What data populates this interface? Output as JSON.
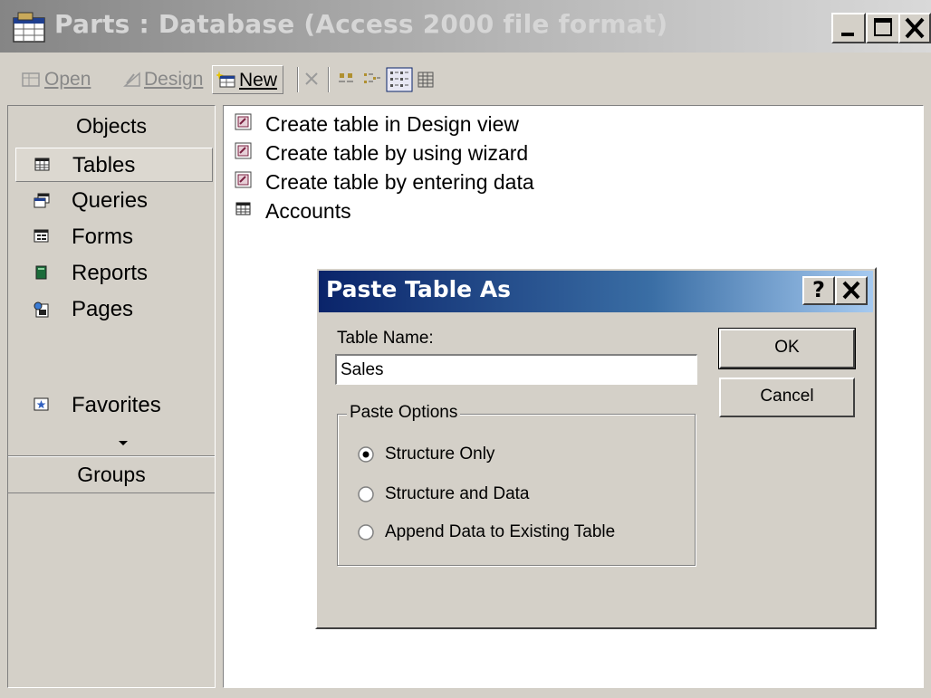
{
  "window": {
    "title": "Parts : Database (Access 2000 file format)"
  },
  "toolbar": {
    "open_label": "Open",
    "design_label": "Design",
    "new_label": "New"
  },
  "objects_pane": {
    "header": "Objects",
    "items": [
      {
        "label": "Tables",
        "icon": "table-icon",
        "selected": true
      },
      {
        "label": "Queries",
        "icon": "query-icon",
        "selected": false
      },
      {
        "label": "Forms",
        "icon": "form-icon",
        "selected": false
      },
      {
        "label": "Reports",
        "icon": "report-icon",
        "selected": false
      },
      {
        "label": "Pages",
        "icon": "page-icon",
        "selected": false
      }
    ],
    "groups_header": "Groups",
    "groups": [
      {
        "label": "Favorites",
        "icon": "favorites-icon"
      }
    ]
  },
  "list": {
    "items": [
      {
        "label": "Create table in Design view",
        "icon": "shortcut-icon"
      },
      {
        "label": "Create table by using wizard",
        "icon": "shortcut-icon"
      },
      {
        "label": "Create table by entering data",
        "icon": "shortcut-icon"
      },
      {
        "label": "Accounts",
        "icon": "table-icon"
      }
    ]
  },
  "dialog": {
    "title": "Paste Table As",
    "help_label": "?",
    "close_label": "×",
    "table_name_label": "Table Name:",
    "table_name_value": "Sales",
    "ok_label": "OK",
    "cancel_label": "Cancel",
    "paste_options_label": "Paste Options",
    "options": [
      {
        "label": "Structure Only",
        "selected": true
      },
      {
        "label": "Structure and Data",
        "selected": false
      },
      {
        "label": "Append Data to Existing Table",
        "selected": false
      }
    ]
  },
  "colors": {
    "dialog_title_start": "#0a246a",
    "dialog_title_end": "#a6caf0",
    "face": "#d4d0c8"
  }
}
